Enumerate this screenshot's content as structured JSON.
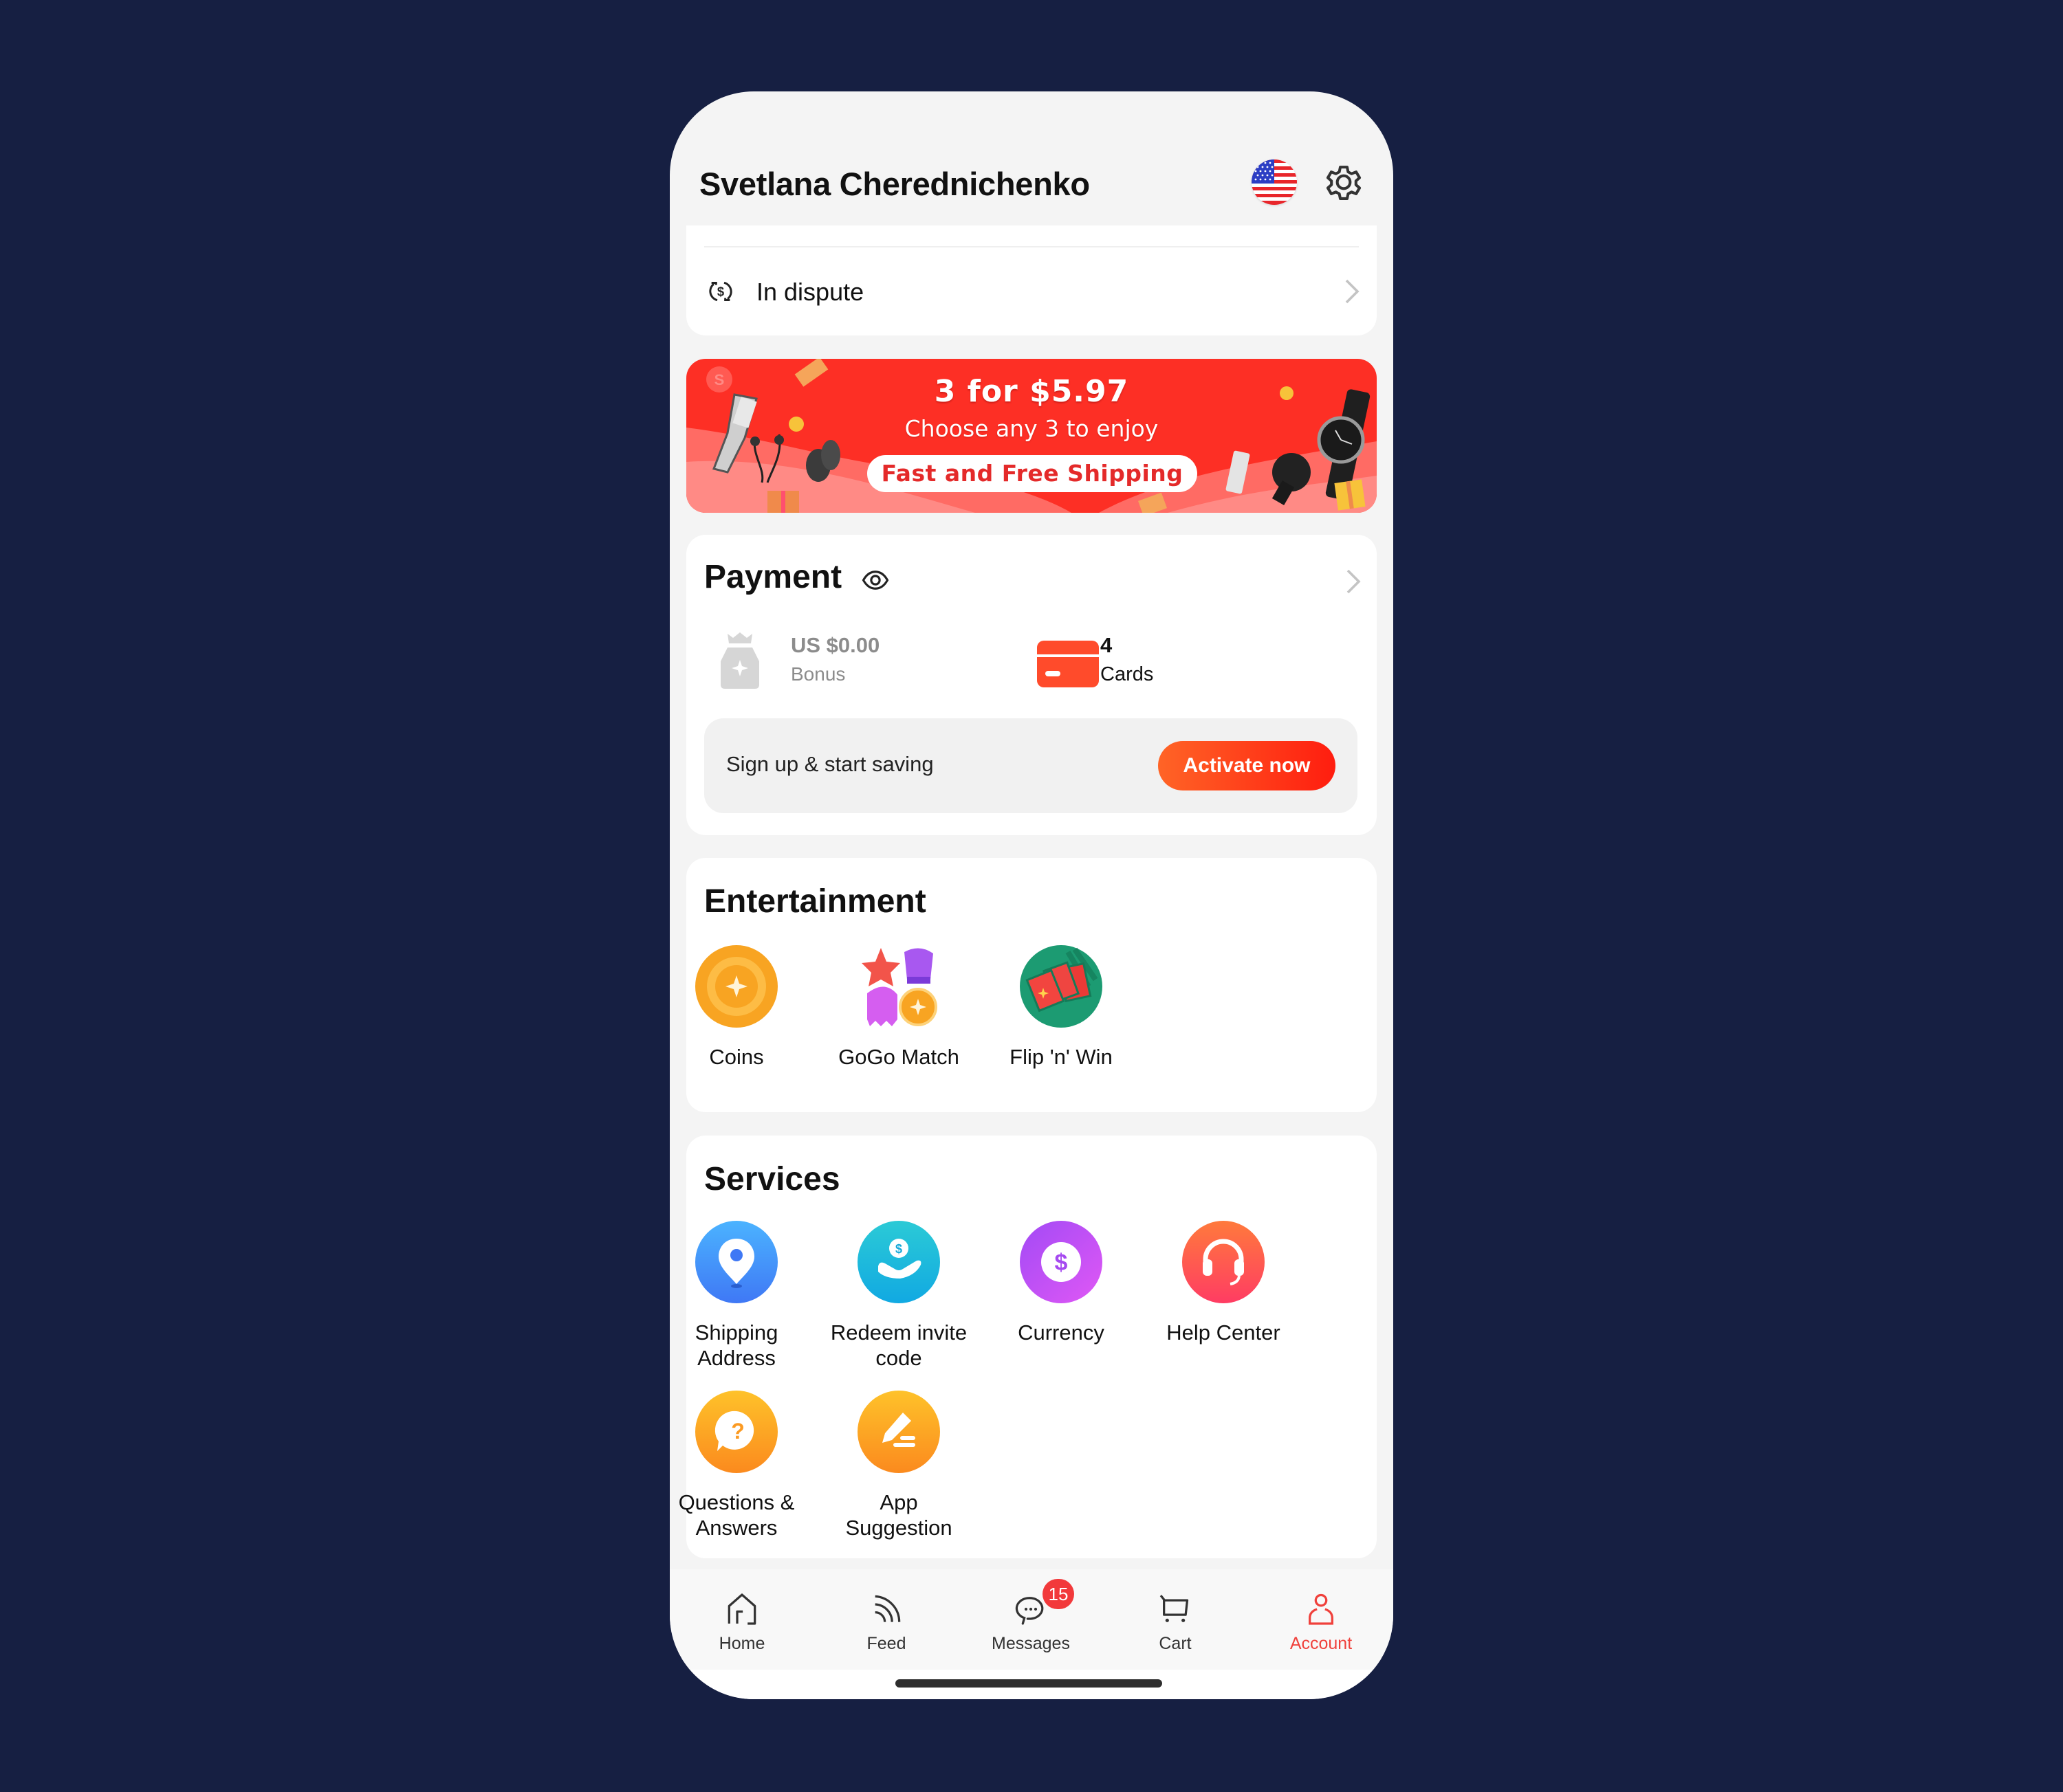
{
  "header": {
    "user_name": "Svetlana Cherednichenko",
    "flag_icon": "us-flag-icon",
    "settings_icon": "gear-icon"
  },
  "orders": {
    "in_dispute_label": "In dispute"
  },
  "banner": {
    "title": "3 for $5.97",
    "subtitle": "Choose any 3 to enjoy",
    "pill": "Fast and Free Shipping"
  },
  "payment": {
    "title": "Payment",
    "bonus_amount": "US $0.00",
    "bonus_label": "Bonus",
    "cards_count": "4",
    "cards_label": "Cards",
    "signup_text": "Sign up & start saving",
    "activate_label": "Activate now"
  },
  "entertainment": {
    "title": "Entertainment",
    "items": [
      {
        "label": "Coins",
        "icon": "coin-icon"
      },
      {
        "label": "GoGo Match",
        "icon": "gogo-match-icon"
      },
      {
        "label": "Flip 'n' Win",
        "icon": "flip-cards-icon"
      }
    ]
  },
  "services": {
    "title": "Services",
    "items": [
      {
        "label": "Shipping Address",
        "icon": "location-pin-icon"
      },
      {
        "label": "Redeem invite code",
        "icon": "hand-coin-icon"
      },
      {
        "label": "Currency",
        "icon": "dollar-icon"
      },
      {
        "label": "Help Center",
        "icon": "headset-icon"
      },
      {
        "label": "Questions & Answers",
        "icon": "question-bubble-icon"
      },
      {
        "label": "App Suggestion",
        "icon": "edit-pen-icon"
      }
    ]
  },
  "tabbar": {
    "items": [
      {
        "label": "Home",
        "icon": "home-icon"
      },
      {
        "label": "Feed",
        "icon": "feed-icon"
      },
      {
        "label": "Messages",
        "icon": "chat-bubble-icon",
        "badge": "15"
      },
      {
        "label": "Cart",
        "icon": "cart-icon"
      },
      {
        "label": "Account",
        "icon": "account-icon",
        "active": true
      }
    ]
  },
  "colors": {
    "accent": "#f0413c",
    "background": "#161f42",
    "banner_red": "#fd2f25",
    "activate_start": "#ff6426",
    "activate_end": "#ff1d0f"
  }
}
